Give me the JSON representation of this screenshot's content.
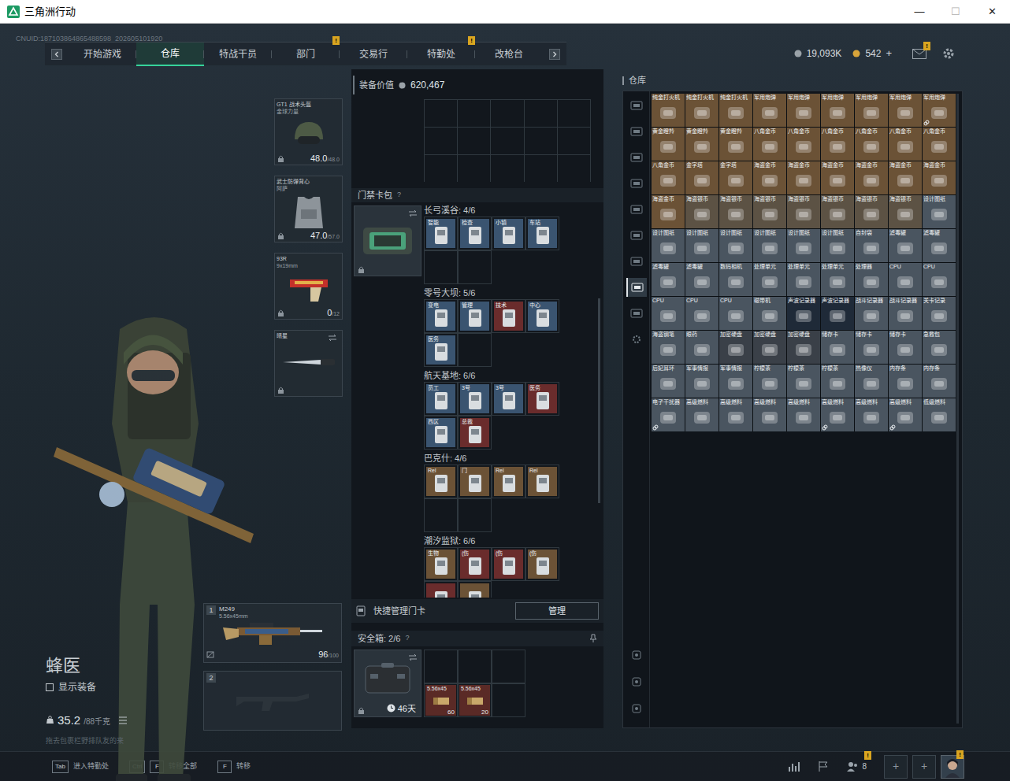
{
  "window": {
    "title": "三角洲行动",
    "controls": [
      "—",
      "☐",
      "✕"
    ]
  },
  "uid": "CNUID:187103864865488598_202605101920",
  "alert_glyph": "!",
  "nav": {
    "tabs": [
      {
        "label": "开始游戏",
        "selected": false,
        "alert": false
      },
      {
        "label": "仓库",
        "selected": true,
        "alert": false
      },
      {
        "label": "特战干员",
        "selected": false,
        "alert": false
      },
      {
        "label": "部门",
        "selected": false,
        "alert": true
      },
      {
        "label": "交易行",
        "selected": false,
        "alert": false
      },
      {
        "label": "特勤处",
        "selected": false,
        "alert": true
      },
      {
        "label": "改枪台",
        "selected": false,
        "alert": false
      }
    ]
  },
  "currency": {
    "coins": "19,093K",
    "tickets": "542",
    "add": "+"
  },
  "mail": {
    "alert": true
  },
  "character": {
    "name": "蜂医",
    "show_gear": {
      "label": "显示装备",
      "checked": false
    },
    "weight": "35.2",
    "weight_max": "/88千克",
    "hint": "拖去包裹栏野排队友的来"
  },
  "gear_slots": [
    {
      "kind": "helmet",
      "name": "GT1 战术头盔",
      "sub": "金球力量",
      "reading": "48.0",
      "max": "/48.0"
    },
    {
      "kind": "armor",
      "name": "武士防弹背心",
      "sub": "阿萨",
      "reading": "47.0",
      "max": "/57.0"
    },
    {
      "kind": "pistol",
      "name": "93R",
      "sub": "9x19mm",
      "reading": "0",
      "max": "/12"
    },
    {
      "kind": "melee",
      "name": "晴星"
    }
  ],
  "weapons": [
    {
      "index": "1",
      "empty": false,
      "name": "M249",
      "caliber": "5.56x45mm",
      "reading": "96",
      "max": "/100"
    },
    {
      "index": "2",
      "empty": true
    }
  ],
  "loadout": {
    "label": "装备价值",
    "value": "620,467"
  },
  "keycards": {
    "title": "门禁卡包",
    "help": "?",
    "maps": [
      {
        "name": "长弓溪谷: 4/6",
        "cards": [
          {
            "label": "智能",
            "color": "#3a5470"
          },
          {
            "label": "检查",
            "color": "#3a5470"
          },
          {
            "label": "小镇",
            "color": "#3a5470"
          },
          {
            "label": "车站",
            "color": "#3a5470"
          }
        ]
      },
      {
        "name": "零号大坝: 5/6",
        "cards": [
          {
            "label": "变电",
            "color": "#3a5470"
          },
          {
            "label": "管理",
            "color": "#3a5470"
          },
          {
            "label": "技术",
            "color": "#6a2c2c"
          },
          {
            "label": "中心",
            "color": "#3a5470"
          },
          {
            "label": "医务",
            "color": "#3a5470"
          }
        ]
      },
      {
        "name": "航天基地: 6/6",
        "cards": [
          {
            "label": "员工",
            "color": "#3a5470"
          },
          {
            "label": "3号",
            "color": "#3a5470"
          },
          {
            "label": "3号",
            "color": "#3a5470"
          },
          {
            "label": "医务",
            "color": "#6a2c2c"
          },
          {
            "label": "西区",
            "color": "#3a5470"
          },
          {
            "label": "总裁",
            "color": "#6a2c2c"
          }
        ]
      },
      {
        "name": "巴克什: 4/6",
        "cards": [
          {
            "label": "Rel",
            "color": "#6b5236"
          },
          {
            "label": "门",
            "color": "#6b5236"
          },
          {
            "label": "Rel",
            "color": "#6b5236"
          },
          {
            "label": "Rel",
            "color": "#6b5236"
          }
        ]
      },
      {
        "name": "潮汐监狱: 6/6",
        "cards": [
          {
            "label": "生物",
            "color": "#6b5236"
          },
          {
            "label": "(伤",
            "color": "#6a2c2c"
          },
          {
            "label": "(伤",
            "color": "#6a2c2c"
          },
          {
            "label": "(伤",
            "color": "#6b5236"
          },
          {
            "label": "",
            "color": "#6a2c2c"
          },
          {
            "label": "",
            "color": "#6b5236"
          }
        ]
      }
    ]
  },
  "quick_manage": {
    "label": "快捷管理门卡",
    "button": "管理"
  },
  "safe": {
    "title": "安全箱: 2/6",
    "help": "?",
    "days": "46天",
    "slots": [
      {
        "filled": false
      },
      {
        "filled": false
      },
      {
        "filled": false
      },
      {
        "filled": true,
        "label": "5.56x45",
        "count": "60",
        "color": "#5a2a26"
      },
      {
        "filled": true,
        "label": "5.56x45",
        "count": "20",
        "color": "#5a2a26"
      },
      {
        "filled": false
      }
    ]
  },
  "warehouse": {
    "title": "仓库",
    "sidebar": [
      {
        "selected": false
      },
      {
        "selected": false
      },
      {
        "selected": false
      },
      {
        "selected": false
      },
      {
        "selected": false
      },
      {
        "selected": false
      },
      {
        "selected": false
      },
      {
        "selected": true
      },
      {
        "selected": false
      },
      {
        "selected": false
      }
    ],
    "tools": [
      {
        "selected": false
      },
      {
        "selected": false
      },
      {
        "selected": false
      }
    ],
    "items": [
      {
        "label": "纯金打火机",
        "color": "#6b5236",
        "bound": false
      },
      {
        "label": "纯金打火机",
        "color": "#6b5236",
        "bound": false
      },
      {
        "label": "纯金打火机",
        "color": "#6b5236",
        "bound": false
      },
      {
        "label": "军用炮弹",
        "color": "#6b5236",
        "bound": false
      },
      {
        "label": "军用炮弹",
        "color": "#6b5236",
        "bound": false
      },
      {
        "label": "军用炮弹",
        "color": "#6b5236",
        "bound": false
      },
      {
        "label": "军用炮弹",
        "color": "#6b5236",
        "bound": false
      },
      {
        "label": "军用炮弹",
        "color": "#6b5236",
        "bound": false
      },
      {
        "label": "军用炮弹",
        "color": "#6b5236",
        "bound": true
      },
      {
        "label": "黄金瞪羚",
        "color": "#6b5236",
        "bound": false
      },
      {
        "label": "黄金瞪羚",
        "color": "#6b5236",
        "bound": false
      },
      {
        "label": "黄金瞪羚",
        "color": "#6b5236",
        "bound": false
      },
      {
        "label": "八角金币",
        "color": "#6b5236",
        "bound": false
      },
      {
        "label": "八角金币",
        "color": "#6b5236",
        "bound": false
      },
      {
        "label": "八角金币",
        "color": "#6b5236",
        "bound": false
      },
      {
        "label": "八角金币",
        "color": "#6b5236",
        "bound": false
      },
      {
        "label": "八角金币",
        "color": "#6b5236",
        "bound": false
      },
      {
        "label": "八角金币",
        "color": "#6b5236",
        "bound": false
      },
      {
        "label": "八角金币",
        "color": "#6b5236",
        "bound": false
      },
      {
        "label": "金字塔",
        "color": "#6b5236",
        "bound": false
      },
      {
        "label": "金字塔",
        "color": "#6b5236",
        "bound": false
      },
      {
        "label": "海盗金币",
        "color": "#6b5236",
        "bound": false
      },
      {
        "label": "海盗金币",
        "color": "#6b5236",
        "bound": false
      },
      {
        "label": "海盗金币",
        "color": "#6b5236",
        "bound": false
      },
      {
        "label": "海盗金币",
        "color": "#6b5236",
        "bound": false
      },
      {
        "label": "海盗金币",
        "color": "#6b5236",
        "bound": false
      },
      {
        "label": "海盗金币",
        "color": "#6b5236",
        "bound": false
      },
      {
        "label": "海盗金币",
        "color": "#6b5236",
        "bound": false
      },
      {
        "label": "海盗银币",
        "color": "#5c5244",
        "bound": false
      },
      {
        "label": "海盗银币",
        "color": "#5c5244",
        "bound": false
      },
      {
        "label": "海盗银币",
        "color": "#5c5244",
        "bound": false
      },
      {
        "label": "海盗银币",
        "color": "#5c5244",
        "bound": false
      },
      {
        "label": "海盗银币",
        "color": "#5c5244",
        "bound": false
      },
      {
        "label": "海盗银币",
        "color": "#5c5244",
        "bound": false
      },
      {
        "label": "海盗银币",
        "color": "#5c5244",
        "bound": false
      },
      {
        "label": "设计图纸",
        "color": "#4a5560",
        "bound": false
      },
      {
        "label": "设计图纸",
        "color": "#4a5560",
        "bound": false
      },
      {
        "label": "设计图纸",
        "color": "#4a5560",
        "bound": false
      },
      {
        "label": "设计图纸",
        "color": "#4a5560",
        "bound": false
      },
      {
        "label": "设计图纸",
        "color": "#4a5560",
        "bound": false
      },
      {
        "label": "设计图纸",
        "color": "#4a5560",
        "bound": false
      },
      {
        "label": "设计图纸",
        "color": "#4a5560",
        "bound": false
      },
      {
        "label": "自封袋",
        "color": "#4a5560",
        "bound": false
      },
      {
        "label": "滤毒罐",
        "color": "#4a5560",
        "bound": false
      },
      {
        "label": "滤毒罐",
        "color": "#4a5560",
        "bound": false
      },
      {
        "label": "滤毒罐",
        "color": "#4a5560",
        "bound": false
      },
      {
        "label": "滤毒罐",
        "color": "#4a5560",
        "bound": false
      },
      {
        "label": "数码相机",
        "color": "#4a5560",
        "bound": false
      },
      {
        "label": "处理单元",
        "color": "#4a5560",
        "bound": false
      },
      {
        "label": "处理单元",
        "color": "#4a5560",
        "bound": false
      },
      {
        "label": "处理单元",
        "color": "#4a5560",
        "bound": false
      },
      {
        "label": "处理器",
        "color": "#4a5560",
        "bound": false
      },
      {
        "label": "CPU",
        "color": "#4a5560",
        "bound": false
      },
      {
        "label": "CPU",
        "color": "#4a5560",
        "bound": false
      },
      {
        "label": "CPU",
        "color": "#4a5560",
        "bound": false
      },
      {
        "label": "CPU",
        "color": "#4a5560",
        "bound": false
      },
      {
        "label": "CPU",
        "color": "#4a5560",
        "bound": false
      },
      {
        "label": "磁带机",
        "color": "#4a5560",
        "bound": false
      },
      {
        "label": "声波记录器",
        "color": "#1f2a38",
        "bound": false
      },
      {
        "label": "声波记录器",
        "color": "#1f2a38",
        "bound": false
      },
      {
        "label": "战斗记录器",
        "color": "#4a5560",
        "bound": false
      },
      {
        "label": "战斗记录器",
        "color": "#4a5560",
        "bound": false
      },
      {
        "label": "关卡记录",
        "color": "#4a5560",
        "bound": false
      },
      {
        "label": "海盗钢笔",
        "color": "#4a5560",
        "bound": false
      },
      {
        "label": "眼药",
        "color": "#4a5560",
        "bound": false
      },
      {
        "label": "加密硬盘",
        "color": "#3a4048",
        "bound": false
      },
      {
        "label": "加密硬盘",
        "color": "#3a4048",
        "bound": false
      },
      {
        "label": "加密硬盘",
        "color": "#3a4048",
        "bound": false
      },
      {
        "label": "储存卡",
        "color": "#4a5560",
        "bound": false
      },
      {
        "label": "储存卡",
        "color": "#4a5560",
        "bound": false
      },
      {
        "label": "储存卡",
        "color": "#4a5560",
        "bound": false
      },
      {
        "label": "急救包",
        "color": "#4a5560",
        "bound": false
      },
      {
        "label": "后妃耳环",
        "color": "#4a5560",
        "bound": false
      },
      {
        "label": "军事情报",
        "color": "#4a5560",
        "bound": false
      },
      {
        "label": "军事情报",
        "color": "#4a5560",
        "bound": false
      },
      {
        "label": "柠檬茶",
        "color": "#4a5560",
        "bound": false
      },
      {
        "label": "柠檬茶",
        "color": "#4a5560",
        "bound": false
      },
      {
        "label": "柠檬茶",
        "color": "#4a5560",
        "bound": false
      },
      {
        "label": "热像仪",
        "color": "#4a5560",
        "bound": false
      },
      {
        "label": "内存条",
        "color": "#4a5560",
        "bound": false
      },
      {
        "label": "内存条",
        "color": "#4a5560",
        "bound": false
      },
      {
        "label": "电子干扰器",
        "color": "#4a5560",
        "bound": true
      },
      {
        "label": "高级燃料",
        "color": "#4a5560",
        "bound": false
      },
      {
        "label": "高级燃料",
        "color": "#4a5560",
        "bound": false
      },
      {
        "label": "高级燃料",
        "color": "#4a5560",
        "bound": false
      },
      {
        "label": "高级燃料",
        "color": "#4a5560",
        "bound": false
      },
      {
        "label": "高级燃料",
        "color": "#4a5560",
        "bound": true
      },
      {
        "label": "高级燃料",
        "color": "#4a5560",
        "bound": false
      },
      {
        "label": "高级燃料",
        "color": "#4a5560",
        "bound": true
      },
      {
        "label": "低级燃料",
        "color": "#4a5560",
        "bound": false
      }
    ]
  },
  "bottom": {
    "keys": [
      {
        "keys": [
          "Tab"
        ],
        "label": "进入特勤处"
      },
      {
        "keys": [
          "Ctrl",
          "F"
        ],
        "label": "转移全部"
      },
      {
        "keys": [
          "F"
        ],
        "label": "转移"
      }
    ],
    "friends": {
      "count": "8",
      "alert": true
    },
    "slots_add": [
      "+",
      "+"
    ],
    "avatar": {
      "alert": true
    }
  }
}
